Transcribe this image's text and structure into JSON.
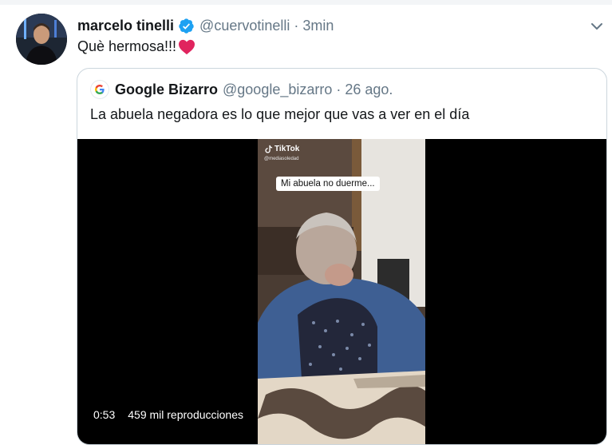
{
  "tweet": {
    "author_name": "marcelo tinelli",
    "handle": "@cuervotinelli",
    "separator": "·",
    "time": "3min",
    "text": "Què hermosa!!!",
    "icons": {
      "verified": "verified-badge-icon",
      "heart": "red-heart-icon",
      "menu": "chevron-down-icon"
    }
  },
  "quoted_tweet": {
    "author_name": "Google Bizarro",
    "handle": "@google_bizarro",
    "separator": "·",
    "date": "26 ago.",
    "text": "La abuela negadora es lo que mejor que vas a ver en el día",
    "video": {
      "watermark": "TikTok",
      "watermark_user": "@mediasoledad",
      "caption": "Mi abuela no duerme...",
      "duration": "0:53",
      "views": "459 mil reproducciones"
    }
  },
  "colors": {
    "verified_blue": "#1da1f2",
    "secondary_text": "#657786",
    "border": "#ccd6dd",
    "heart_red": "#e0245e"
  }
}
